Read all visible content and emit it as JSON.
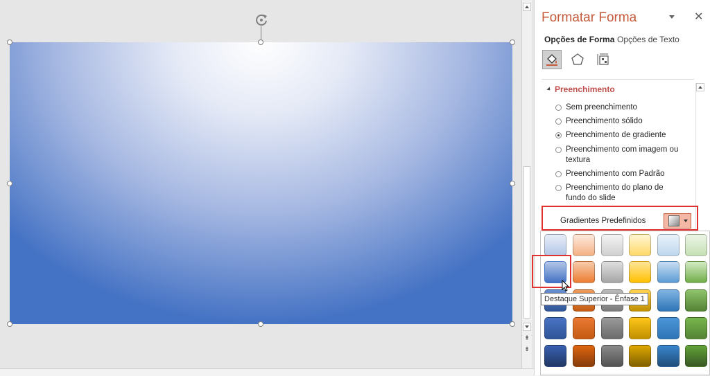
{
  "pane": {
    "title": "Formatar Forma",
    "tabs": [
      {
        "label": "Opções de Forma",
        "active": true
      },
      {
        "label": "Opções de Texto",
        "active": false
      }
    ],
    "category_icons": [
      "paint-bucket-icon",
      "pentagon-icon",
      "size-properties-icon"
    ],
    "section": {
      "label": "Preenchimento",
      "color": "#c0504d"
    },
    "fill_options": [
      {
        "label": "Sem preenchimento",
        "selected": false
      },
      {
        "label": "Preenchimento sólido",
        "selected": false
      },
      {
        "label": "Preenchimento de gradiente",
        "selected": true
      },
      {
        "label": "Preenchimento com imagem ou textura",
        "selected": false
      },
      {
        "label": "Preenchimento com Padrão",
        "selected": false
      },
      {
        "label": "Preenchimento do plano de fundo do slide",
        "selected": false
      }
    ],
    "preset_gradients_label": "Gradientes Predefinidos"
  },
  "gallery": {
    "tooltip": "Destaque Superior - Ênfase 1",
    "hovered": {
      "row": 1,
      "col": 0
    },
    "rows": [
      [
        [
          "#e8eef8",
          "#b4c7e7"
        ],
        [
          "#fde9de",
          "#f4b183"
        ],
        [
          "#f4f4f4",
          "#d0d0d0"
        ],
        [
          "#fff6d5",
          "#ffd966"
        ],
        [
          "#eaf2fa",
          "#bdd7ee"
        ],
        [
          "#ecf5e6",
          "#c5e0b4"
        ]
      ],
      [
        [
          "#b4c7e7",
          "#4472c4"
        ],
        [
          "#f8cbad",
          "#ed7d31"
        ],
        [
          "#e0e0e0",
          "#a5a5a5"
        ],
        [
          "#ffe699",
          "#ffc000"
        ],
        [
          "#c9def2",
          "#5b9bd5"
        ],
        [
          "#d3ebc5",
          "#70ad47"
        ]
      ],
      [
        [
          "#6a8fd0",
          "#2f5597"
        ],
        [
          "#f09a5a",
          "#c55a11"
        ],
        [
          "#b9b9b9",
          "#7b7b7b"
        ],
        [
          "#ffd452",
          "#bf9000"
        ],
        [
          "#7fb3e3",
          "#2e75b6"
        ],
        [
          "#8fc46a",
          "#548235"
        ]
      ],
      [
        [
          "#4a74c4",
          "#2f5597"
        ],
        [
          "#ea7a35",
          "#c55a11"
        ],
        [
          "#9a9a9a",
          "#6b6b6b"
        ],
        [
          "#ffc61a",
          "#bf9000"
        ],
        [
          "#4c95d8",
          "#2e75b6"
        ],
        [
          "#77b74c",
          "#548235"
        ]
      ],
      [
        [
          "#3960b0",
          "#203864"
        ],
        [
          "#e0650f",
          "#843c0c"
        ],
        [
          "#8a8a8a",
          "#525252"
        ],
        [
          "#e0a800",
          "#7f6000"
        ],
        [
          "#3a85cc",
          "#1f4e79"
        ],
        [
          "#62a339",
          "#385723"
        ]
      ]
    ]
  },
  "colors": {
    "accent": "#c55a3b",
    "shape_center": "#ffffff",
    "shape_edge": "#4472c4",
    "highlight_border": "#e03030"
  }
}
